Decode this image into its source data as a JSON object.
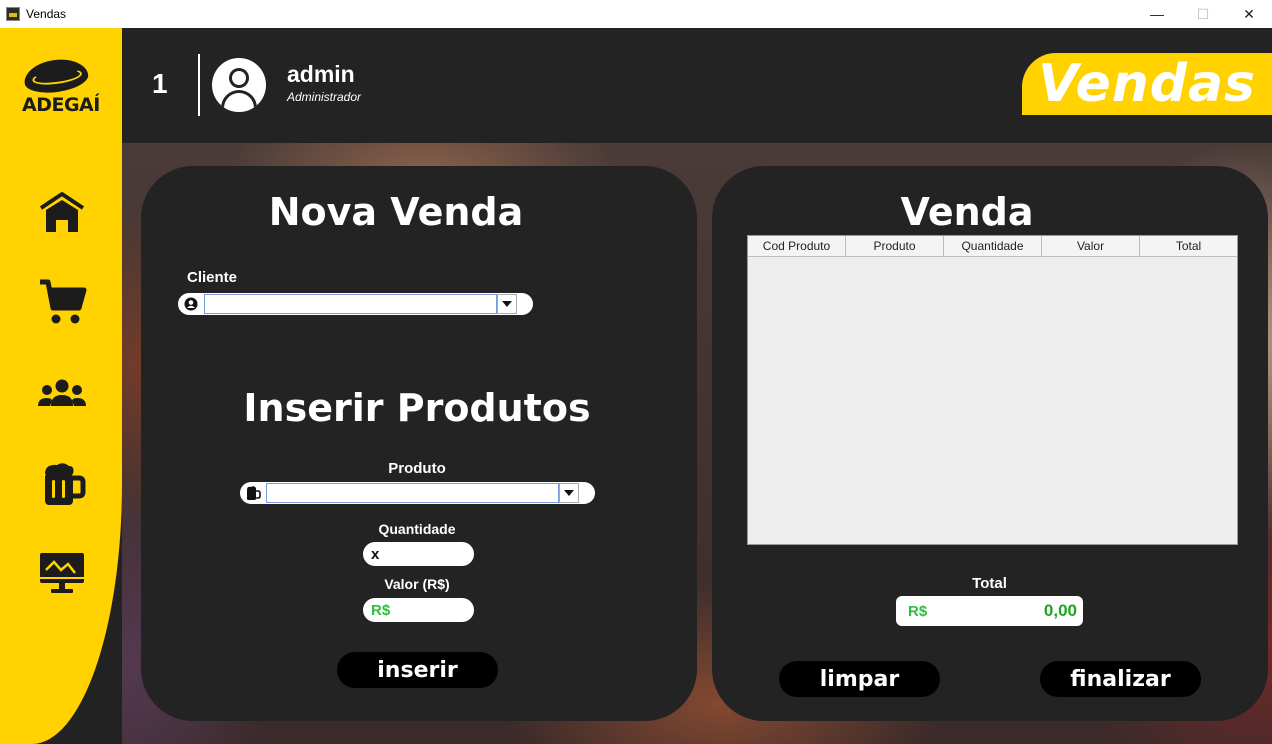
{
  "window": {
    "title": "Vendas"
  },
  "header": {
    "user_number": "1",
    "user_name": "admin",
    "user_role": "Administrador",
    "brand_title": "Vendas"
  },
  "sidebar": {
    "logo_text": "ADEGAÍ",
    "items": [
      {
        "icon": "home-icon"
      },
      {
        "icon": "cart-icon"
      },
      {
        "icon": "users-icon"
      },
      {
        "icon": "beer-mug-icon"
      },
      {
        "icon": "monitor-chart-icon"
      }
    ]
  },
  "nova_venda": {
    "title": "Nova Venda",
    "cliente_label": "Cliente",
    "cliente_value": "",
    "inserir_title": "Inserir Produtos",
    "produto_label": "Produto",
    "produto_value": "",
    "quantidade_label": "Quantidade",
    "quantidade_prefix": "x",
    "quantidade_value": "",
    "valor_label": "Valor (R$)",
    "valor_prefix": "R$",
    "valor_value": "",
    "inserir_button": "inserir"
  },
  "venda": {
    "title": "Venda",
    "columns": [
      "Cod Produto",
      "Produto",
      "Quantidade",
      "Valor",
      "Total"
    ],
    "rows": [],
    "total_label": "Total",
    "total_prefix": "R$",
    "total_value": "0,00",
    "limpar_button": "limpar",
    "finalizar_button": "finalizar"
  },
  "colors": {
    "accent": "#ffd200",
    "panel": "#232323",
    "money_green": "#2fbf3a"
  }
}
